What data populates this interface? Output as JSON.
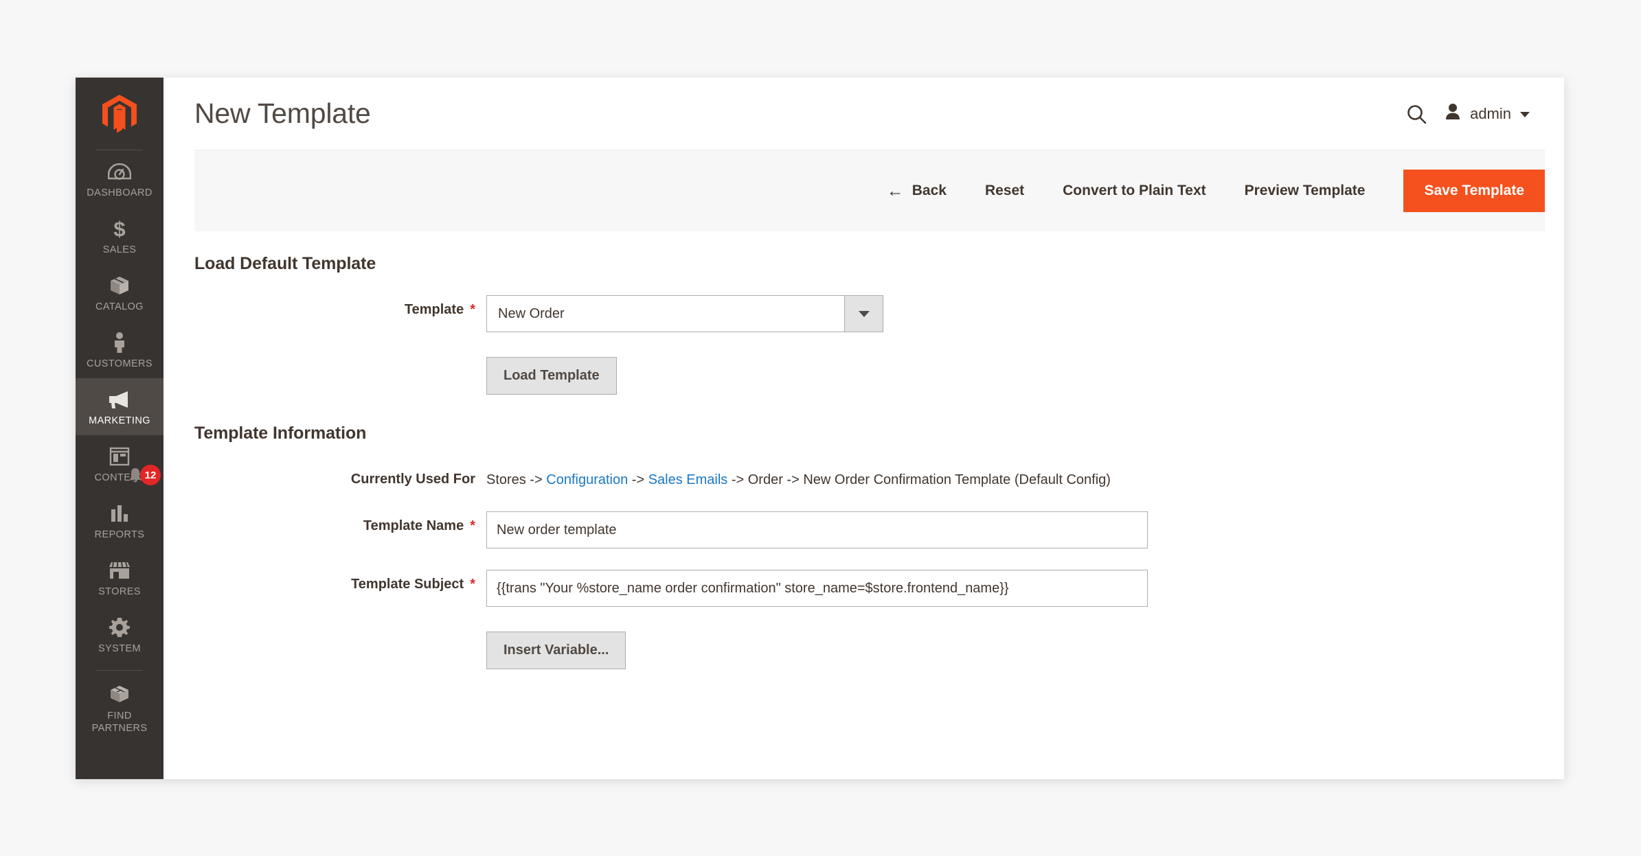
{
  "header": {
    "title": "New Template",
    "search_icon": "search-icon",
    "user_icon": "user-avatar-icon",
    "user_name": "admin",
    "caret_icon": "chevron-down-icon"
  },
  "sidebar": {
    "logo": "magento-logo-icon",
    "items": [
      {
        "label": "DASHBOARD",
        "icon": "dashboard-gauge-icon",
        "active": false
      },
      {
        "label": "SALES",
        "icon": "dollar-sign-icon",
        "active": false
      },
      {
        "label": "CATALOG",
        "icon": "box-icon",
        "active": false
      },
      {
        "label": "CUSTOMERS",
        "icon": "person-icon",
        "active": false
      },
      {
        "label": "MARKETING",
        "icon": "megaphone-icon",
        "active": true
      },
      {
        "label": "CONTENT",
        "icon": "layout-icon",
        "active": false,
        "badge": "12",
        "badge_icon": "bell-icon"
      },
      {
        "label": "REPORTS",
        "icon": "bar-chart-icon",
        "active": false
      },
      {
        "label": "STORES",
        "icon": "storefront-icon",
        "active": false
      },
      {
        "label": "SYSTEM",
        "icon": "gear-icon",
        "active": false
      },
      {
        "label": "FIND PARTNERS",
        "icon": "extensions-blocks-icon",
        "active": false
      }
    ]
  },
  "toolbar": {
    "back_label": "Back",
    "back_arrow": "←",
    "reset_label": "Reset",
    "convert_label": "Convert to Plain Text",
    "preview_label": "Preview Template",
    "save_label": "Save Template"
  },
  "load_default": {
    "section_title": "Load Default Template",
    "template_label": "Template",
    "required_marker": "*",
    "template_value": "New Order",
    "load_button_label": "Load Template"
  },
  "template_info": {
    "section_title": "Template Information",
    "currently_used_for_label": "Currently Used For",
    "used_for": {
      "part1": "Stores -> ",
      "link1": "Configuration",
      "part2": " -> ",
      "link2": "Sales Emails",
      "part3": " -> Order -> New Order Confirmation Template  (Default Config)"
    },
    "template_name_label": "Template Name",
    "template_name_value": "New order template",
    "template_subject_label": "Template Subject",
    "template_subject_value": "{{trans \"Your %store_name order confirmation\" store_name=$store.frontend_name}}",
    "insert_variable_label": "Insert Variable..."
  },
  "colors": {
    "accent_orange": "#f4511e",
    "logo_orange": "#f4501e",
    "sidebar_bg": "#373330",
    "sidebar_active": "#4f4a46",
    "link_blue": "#1979c3",
    "required_red": "#e02b27",
    "badge_red": "#e22626"
  }
}
